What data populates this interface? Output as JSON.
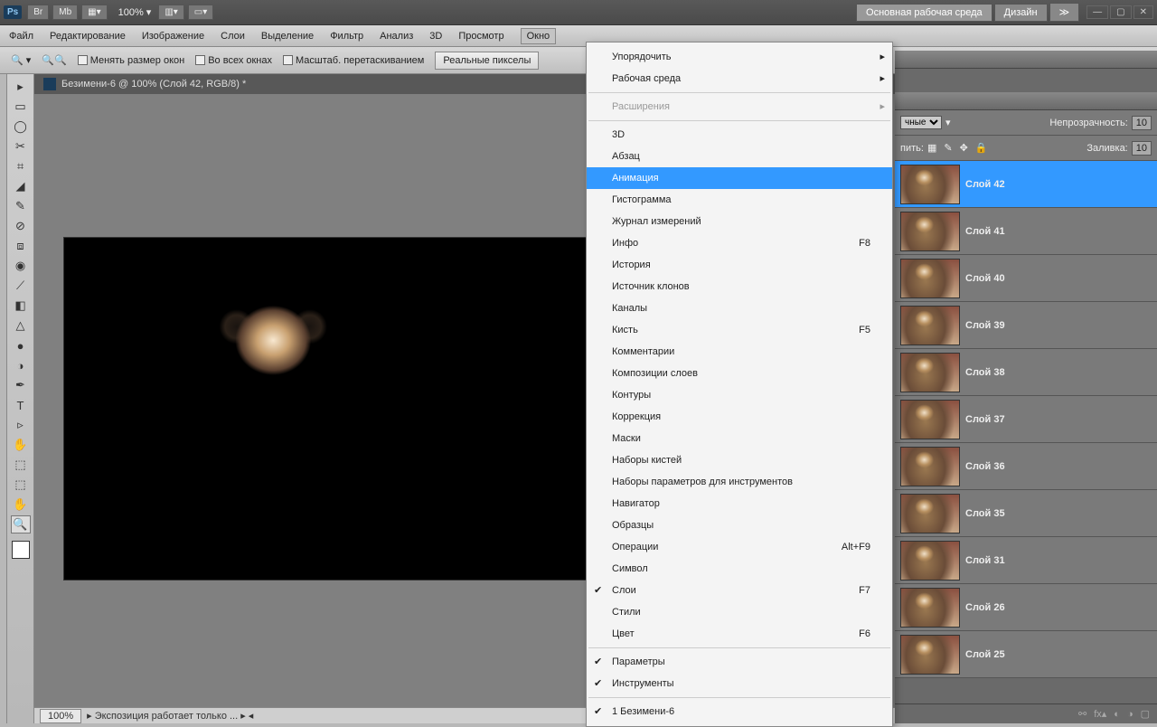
{
  "topbar": {
    "zoom": "100%",
    "workspace_active": "Основная рабочая среда",
    "workspace_other": "Дизайн",
    "br": "Br",
    "mb": "Mb"
  },
  "menubar": {
    "items": [
      "Файл",
      "Редактирование",
      "Изображение",
      "Слои",
      "Выделение",
      "Фильтр",
      "Анализ",
      "3D",
      "Просмотр",
      "Окно"
    ],
    "open_index": 9
  },
  "optbar": {
    "cb1": "Менять размер окон",
    "cb2": "Во всех окнах",
    "cb3": "Масштаб. перетаскиванием",
    "btn1": "Реальные пикселы"
  },
  "document": {
    "tab_title": "Безимени-6 @ 100% (Слой 42, RGB/8) *",
    "status_zoom": "100%",
    "status_text": "Экспозиция работает только ..."
  },
  "dropdown": {
    "groups": [
      [
        {
          "label": "Упорядочить",
          "sub": true
        },
        {
          "label": "Рабочая среда",
          "sub": true
        }
      ],
      [
        {
          "label": "Расширения",
          "sub": true,
          "disabled": true
        }
      ],
      [
        {
          "label": "3D"
        },
        {
          "label": "Абзац"
        },
        {
          "label": "Анимация",
          "highlight": true
        },
        {
          "label": "Гистограмма"
        },
        {
          "label": "Журнал измерений"
        },
        {
          "label": "Инфо",
          "shortcut": "F8"
        },
        {
          "label": "История"
        },
        {
          "label": "Источник клонов"
        },
        {
          "label": "Каналы"
        },
        {
          "label": "Кисть",
          "shortcut": "F5"
        },
        {
          "label": "Комментарии"
        },
        {
          "label": "Композиции слоев"
        },
        {
          "label": "Контуры"
        },
        {
          "label": "Коррекция"
        },
        {
          "label": "Маски"
        },
        {
          "label": "Наборы кистей"
        },
        {
          "label": "Наборы параметров для инструментов"
        },
        {
          "label": "Навигатор"
        },
        {
          "label": "Образцы"
        },
        {
          "label": "Операции",
          "shortcut": "Alt+F9"
        },
        {
          "label": "Символ"
        },
        {
          "label": "Слои",
          "shortcut": "F7",
          "checked": true
        },
        {
          "label": "Стили"
        },
        {
          "label": "Цвет",
          "shortcut": "F6"
        }
      ],
      [
        {
          "label": "Параметры",
          "checked": true
        },
        {
          "label": "Инструменты",
          "checked": true
        }
      ],
      [
        {
          "label": "1 Безимени-6",
          "checked": true
        }
      ]
    ]
  },
  "panels": {
    "blend_suffix": "чные",
    "opacity_label": "Непрозрачность:",
    "opacity_val": "10",
    "lock_label": "пить:",
    "fill_label": "Заливка:",
    "fill_val": "10",
    "layers": [
      {
        "name": "Слой 42",
        "selected": true
      },
      {
        "name": "Слой 41"
      },
      {
        "name": "Слой 40"
      },
      {
        "name": "Слой 39"
      },
      {
        "name": "Слой 38"
      },
      {
        "name": "Слой 37"
      },
      {
        "name": "Слой 36"
      },
      {
        "name": "Слой 35"
      },
      {
        "name": "Слой 31"
      },
      {
        "name": "Слой 26"
      },
      {
        "name": "Слой 25"
      }
    ]
  },
  "tools": [
    "▸",
    "▭",
    "◯",
    "✂",
    "⌗",
    "◢",
    "✎",
    "⊘",
    "⧈",
    "◉",
    "⟋",
    "◧",
    "△",
    "●",
    "◑",
    "✒",
    "T",
    "▹",
    "✋",
    "⬚",
    "⬚",
    "✋",
    "🔍"
  ]
}
